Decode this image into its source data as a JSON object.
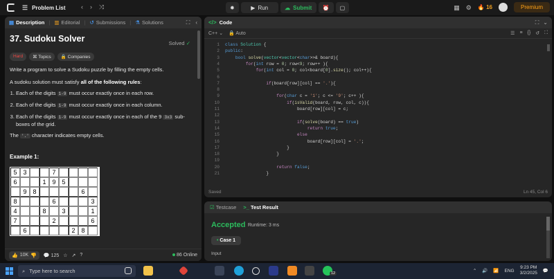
{
  "topbar": {
    "title": "Problem List",
    "run": "Run",
    "submit": "Submit",
    "streak": "16",
    "premium": "Premium"
  },
  "left": {
    "tabs": [
      "Description",
      "Editorial",
      "Submissions",
      "Solutions"
    ],
    "title": "37. Sudoku Solver",
    "solved": "Solved",
    "tags": [
      "Hard",
      "Topics",
      "Companies"
    ],
    "p1": "Write a program to solve a Sudoku puzzle by filling the empty cells.",
    "p2_pre": "A sudoku solution must satisfy ",
    "p2_bold": "all of the following rules",
    "p2_post": ":",
    "rule1_pre": "Each of the digits ",
    "rule1_code": "1-9",
    "rule1_post": " must occur exactly once in each row.",
    "rule2_pre": "Each of the digits ",
    "rule2_code": "1-9",
    "rule2_post": " must occur exactly once in each column.",
    "rule3_pre": "Each of the digits ",
    "rule3_code": "1-9",
    "rule3_mid": " must occur exactly once in each of the 9 ",
    "rule3_code2": "3x3",
    "rule3_post": " sub-boxes of the grid.",
    "p3_pre": "The ",
    "p3_code": "'.'",
    "p3_post": " character indicates empty cells.",
    "example": "Example 1:",
    "grid": [
      [
        "5",
        "3",
        "",
        "",
        "7",
        "",
        "",
        "",
        ""
      ],
      [
        "6",
        "",
        "",
        "1",
        "9",
        "5",
        "",
        "",
        ""
      ],
      [
        "",
        "9",
        "8",
        "",
        "",
        "",
        "",
        "6",
        ""
      ],
      [
        "8",
        "",
        "",
        "",
        "6",
        "",
        "",
        "",
        "3"
      ],
      [
        "4",
        "",
        "",
        "8",
        "",
        "3",
        "",
        "",
        "1"
      ],
      [
        "7",
        "",
        "",
        "",
        "2",
        "",
        "",
        "",
        "6"
      ],
      [
        "",
        "6",
        "",
        "",
        "",
        "",
        "2",
        "8",
        ""
      ]
    ],
    "likes": "10K",
    "comments": "125",
    "online": "86 Online"
  },
  "code": {
    "header": "Code",
    "lang": "C++",
    "auto": "Auto",
    "lines": [
      "1",
      "2",
      "3",
      "4",
      "5",
      "6",
      "7",
      "8",
      "9",
      "10",
      "11",
      "12",
      "13",
      "14",
      "15",
      "16",
      "17",
      "18",
      "19",
      "20",
      "21"
    ],
    "saved": "Saved",
    "cursor": "Ln 45, Col 6"
  },
  "result": {
    "tab1": "Testcase",
    "tab2": "Test Result",
    "status": "Accepted",
    "runtime": "Runtime: 3 ms",
    "case": "Case 1",
    "input": "Input"
  },
  "taskbar": {
    "search": "Type here to search",
    "lang": "ENG",
    "time": "9:23 PM",
    "date": "3/2/2025",
    "badge": "12"
  }
}
